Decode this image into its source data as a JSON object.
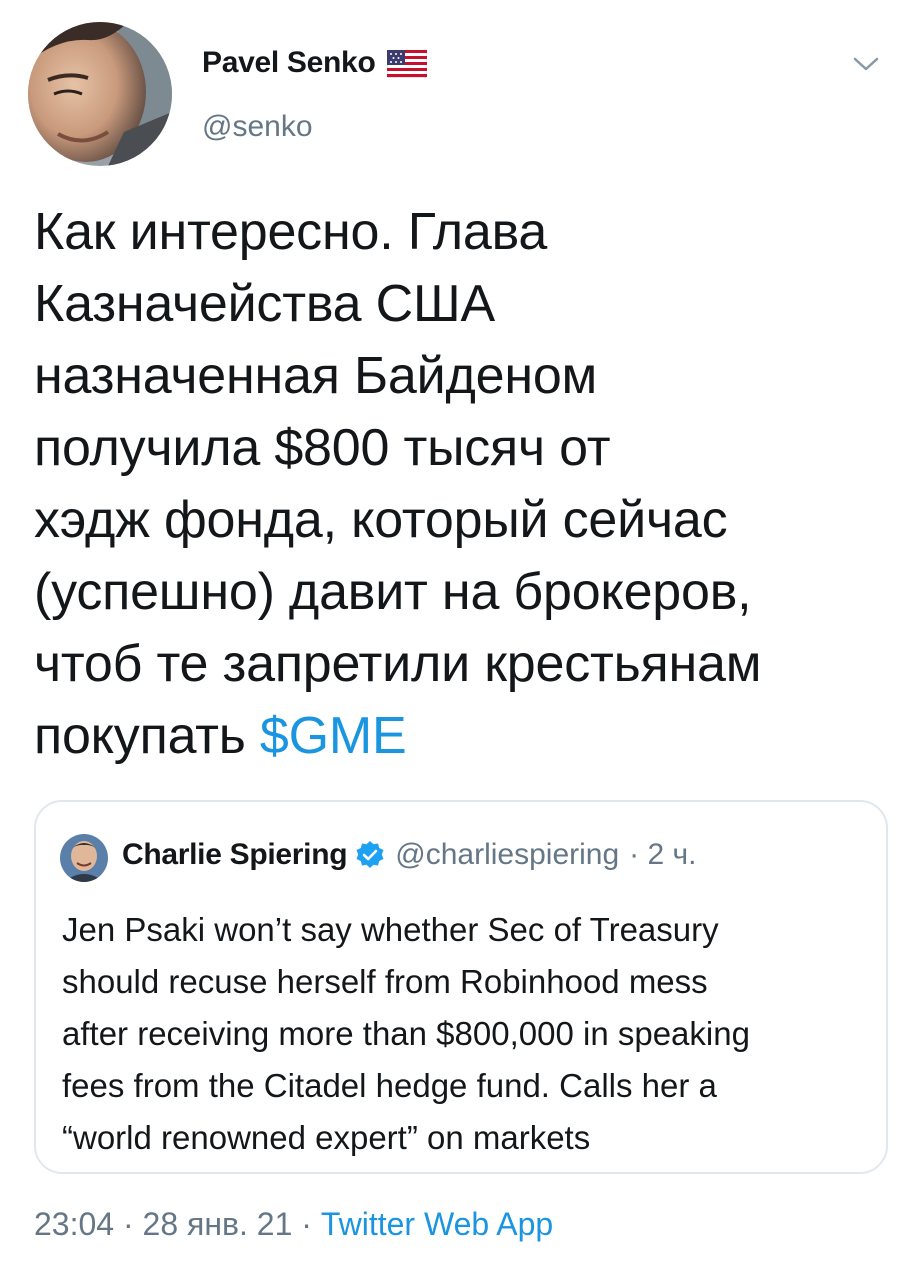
{
  "author": {
    "display_name": "Pavel Senko",
    "handle": "@senko",
    "flag_icon": "us-flag-icon"
  },
  "tweet": {
    "text_lines": [
      "Как интересно. Глава",
      "Казначейства США",
      "назначенная Байденом",
      "получила $800 тысяч от",
      "хэдж фонда, который сейчас",
      "(успешно) давит на брокеров,",
      "чтоб те запретили крестьянам",
      "покупать "
    ],
    "cashtag": "$GME"
  },
  "quoted_tweet": {
    "display_name": "Charlie Spiering",
    "handle": "@charliespiering",
    "time": "· 2 ч.",
    "text_lines": [
      "Jen Psaki won’t say whether Sec of Treasury",
      "should recuse herself from Robinhood mess",
      "after receiving more than $800,000 in speaking",
      "fees from the Citadel hedge fund. Calls her a",
      "“world renowned expert” on markets"
    ]
  },
  "footer": {
    "time": "23:04",
    "separator": "·",
    "date": "28 янв. 21",
    "source": "Twitter Web App"
  },
  "colors": {
    "link": "#1b95e0",
    "text": "#14171a",
    "secondary": "#657786",
    "border": "#e1e8ed"
  }
}
